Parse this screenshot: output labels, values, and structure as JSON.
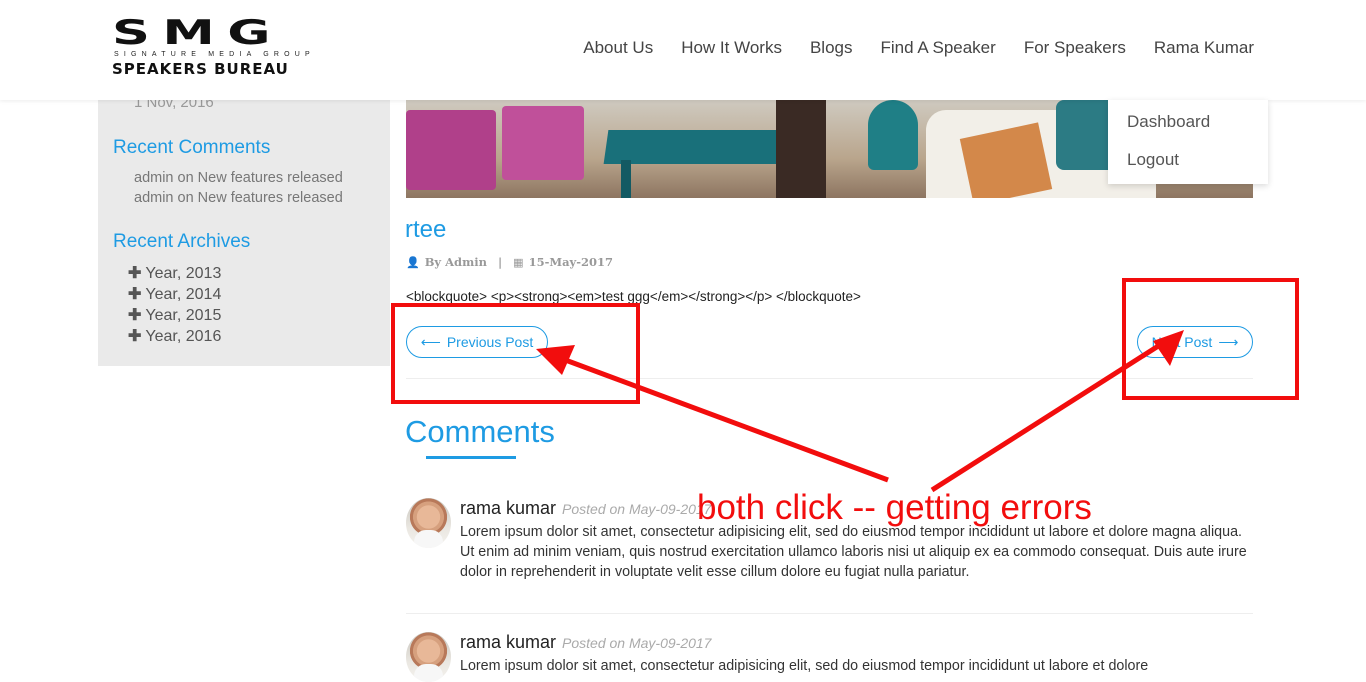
{
  "header": {
    "logo_big": "SMG",
    "logo_mid": "SIGNATURE MEDIA GROUP",
    "logo_small": "SPEAKERS BUREAU",
    "nav": [
      "About Us",
      "How It Works",
      "Blogs",
      "Find A Speaker",
      "For Speakers",
      "Rama Kumar"
    ]
  },
  "user_menu": {
    "items": [
      "Dashboard",
      "Logout"
    ]
  },
  "sidebar": {
    "date": "1 Nov, 2016",
    "recent_comments_title": "Recent Comments",
    "recent_comments": [
      "admin on New features released",
      "admin on New features released"
    ],
    "recent_archives_title": "Recent Archives",
    "archives": [
      "Year, 2013",
      "Year, 2014",
      "Year, 2015",
      "Year, 2016"
    ]
  },
  "post": {
    "title": "rtee",
    "author": "By Admin",
    "date": "15-May-2017",
    "body": "<blockquote> <p><strong><em>test ggg</em></strong></p> </blockquote>",
    "prev_label": "Previous Post",
    "next_label": "Next Post"
  },
  "comments": {
    "title": "Comments",
    "items": [
      {
        "name": "rama kumar",
        "date": "Posted on May-09-2017",
        "text": "Lorem ipsum dolor sit amet, consectetur adipisicing elit, sed do eiusmod tempor incididunt ut labore et dolore magna aliqua. Ut enim ad minim veniam, quis nostrud exercitation ullamco laboris nisi ut aliquip ex ea commodo consequat. Duis aute irure dolor in reprehenderit in voluptate velit esse cillum dolore eu fugiat nulla pariatur."
      },
      {
        "name": "rama kumar",
        "date": "Posted on May-09-2017",
        "text": "Lorem ipsum dolor sit amet, consectetur adipisicing elit, sed do eiusmod tempor incididunt ut labore et dolore"
      }
    ]
  },
  "annotation": {
    "text": "both click -- getting errors",
    "color": "#f20d0d"
  },
  "colors": {
    "accent": "#1e9be3"
  }
}
